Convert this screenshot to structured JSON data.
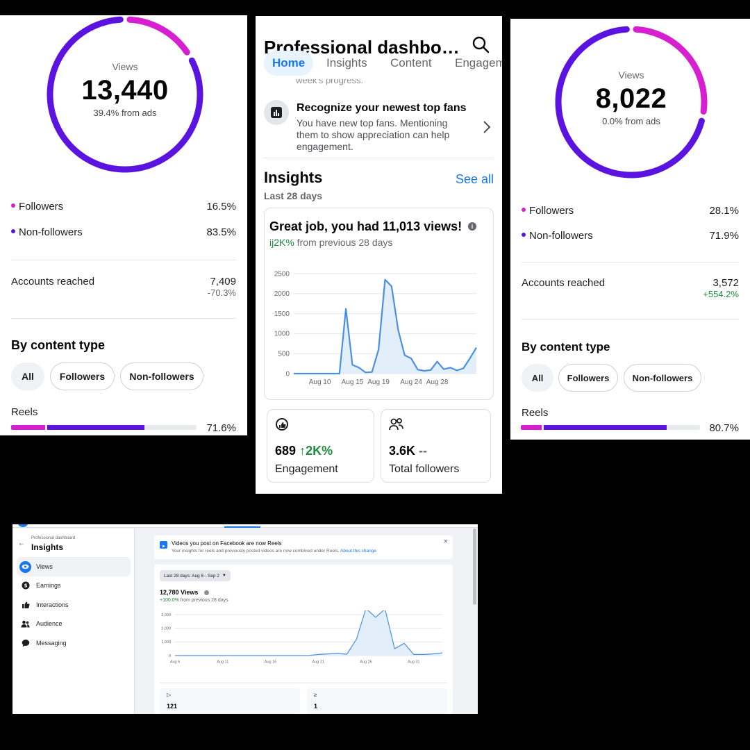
{
  "panel_left": {
    "views_caption": "Views",
    "views_value": "13,440",
    "views_sub": "39.4% from ads",
    "followers_label": "Followers",
    "followers_pct": "16.5%",
    "nonfollowers_label": "Non-followers",
    "nonfollowers_pct": "83.5%",
    "reached_label": "Accounts reached",
    "reached_value": "7,409",
    "reached_change": "-70.3%",
    "content_type_title": "By content type",
    "filter_all": "All",
    "filter_followers": "Followers",
    "filter_nonfollowers": "Non-followers",
    "reels_label": "Reels",
    "reels_pct": "71.6%"
  },
  "panel_right": {
    "views_caption": "Views",
    "views_value": "8,022",
    "views_sub": "0.0% from ads",
    "followers_label": "Followers",
    "followers_pct": "28.1%",
    "nonfollowers_label": "Non-followers",
    "nonfollowers_pct": "71.9%",
    "reached_label": "Accounts reached",
    "reached_value": "3,572",
    "reached_change": "+554.2%",
    "content_type_title": "By content type",
    "filter_all": "All",
    "filter_followers": "Followers",
    "filter_nonfollowers": "Non-followers",
    "reels_label": "Reels",
    "reels_pct": "80.7%"
  },
  "panel_mobile": {
    "title": "Professional dashbo…",
    "tabs": [
      "Home",
      "Insights",
      "Content",
      "Engagem"
    ],
    "partial_text": "week's progress.",
    "fans_title": "Recognize your newest top fans",
    "fans_body": "You have new top fans. Mentioning them to show appreciation can help engagement.",
    "insights_title": "Insights",
    "see_all": "See all",
    "period": "Last 28 days",
    "card_headline": "Great job, you had 11,013 views!",
    "card_change": "ij2K%",
    "card_change_suffix": " from previous 28 days",
    "engagement_value": "689",
    "engagement_change": "↑2K%",
    "engagement_label": "Engagement",
    "followers_value": "3.6K",
    "followers_change": "--",
    "followers_label": "Total followers"
  },
  "panel_desktop": {
    "breadcrumb": "Professional dashboard",
    "title": "Insights",
    "nav": [
      {
        "label": "Views",
        "icon": "eye-icon"
      },
      {
        "label": "Earnings",
        "icon": "dollar-icon"
      },
      {
        "label": "Interactions",
        "icon": "thumbs-up-icon"
      },
      {
        "label": "Audience",
        "icon": "people-icon"
      },
      {
        "label": "Messaging",
        "icon": "chat-icon"
      }
    ],
    "banner_title": "Videos you post on Facebook are now Reels",
    "banner_body": "Your insights for reels and previously posted videos are now combined under Reels.",
    "banner_link": "About this change",
    "date_filter": "Last 28 days: Aug 6 - Sep 2",
    "views_value": "12,780 Views",
    "views_change": "+100.0%",
    "views_change_suffix": " from previous 28 days",
    "stat1_value": "121",
    "stat2_value": "1"
  },
  "chart_data": [
    {
      "type": "area",
      "id": "mobile-views",
      "x_ticks": [
        "Aug 10",
        "Aug 15",
        "Aug 19",
        "Aug 24",
        "Aug 28"
      ],
      "y_ticks": [
        "2500",
        "2000",
        "1500",
        "1000",
        "500",
        "0"
      ],
      "ylim": [
        0,
        2500
      ],
      "xlim": [
        6,
        34
      ],
      "x": [
        6,
        7,
        8,
        9,
        10,
        11,
        12,
        13,
        14,
        15,
        16,
        17,
        18,
        19,
        20,
        21,
        22,
        23,
        24,
        25,
        26,
        27,
        28,
        29,
        30,
        31,
        32,
        33,
        34
      ],
      "y": [
        0,
        0,
        0,
        0,
        0,
        0,
        0,
        0,
        1620,
        220,
        150,
        30,
        40,
        600,
        2350,
        2180,
        1100,
        460,
        380,
        100,
        70,
        90,
        300,
        110,
        150,
        80,
        130,
        380,
        650
      ],
      "color": "#4a90e2",
      "fill": "#e3eefb"
    },
    {
      "type": "area",
      "id": "desktop-views",
      "x_ticks": [
        "Aug 6",
        "Aug 11",
        "Aug 16",
        "Aug 21",
        "Aug 26",
        "Aug 31"
      ],
      "y_ticks": [
        "3,000",
        "2,000",
        "1,000",
        "0"
      ],
      "ylim": [
        0,
        3000
      ],
      "xlim": [
        6,
        34
      ],
      "x": [
        6,
        7,
        8,
        9,
        10,
        11,
        12,
        13,
        14,
        15,
        16,
        17,
        18,
        19,
        20,
        21,
        22,
        23,
        24,
        25,
        26,
        27,
        28,
        29,
        30,
        31,
        32,
        33,
        34
      ],
      "y": [
        0,
        0,
        0,
        0,
        0,
        0,
        0,
        0,
        0,
        0,
        0,
        0,
        0,
        0,
        0,
        80,
        120,
        150,
        100,
        1200,
        3450,
        2800,
        3400,
        500,
        900,
        80,
        80,
        120,
        200
      ],
      "color": "#4a90e2",
      "fill": "#e3eefb"
    }
  ],
  "colors": {
    "ring_purple": "#5b14e0",
    "ring_magenta": "#d61fd0",
    "fb_blue": "#1877f2",
    "positive_green": "#1e8e3e"
  },
  "ring_shares": {
    "left": {
      "magenta": 0.165,
      "purple": 0.835
    },
    "right": {
      "magenta": 0.281,
      "purple": 0.719
    }
  },
  "reels_bar": {
    "left": {
      "magenta": 0.185,
      "purple": 0.528
    },
    "right": {
      "magenta": 0.118,
      "purple": 0.689
    }
  }
}
